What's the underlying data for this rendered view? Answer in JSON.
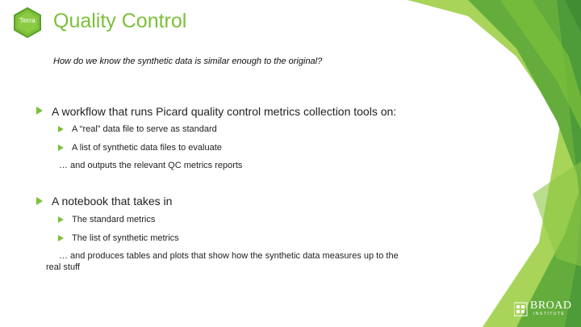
{
  "slide": {
    "title": "Quality Control",
    "subtitle": "How do we know the synthetic data is similar enough to the original?",
    "logo_text": "Terra",
    "colors": {
      "accent_green": "#7cc03a",
      "dark_green": "#4e9b3a",
      "mid_green": "#64ad3c",
      "light_green": "#a8d45a"
    },
    "bullets": [
      {
        "text": "A workflow that runs Picard quality control metrics collection tools on:",
        "sub": [
          "A “real” data file to serve as standard",
          "A list of synthetic data files to evaluate"
        ],
        "continuation": [
          "… and outputs the relevant QC metrics reports"
        ]
      },
      {
        "text": "A notebook that takes in",
        "sub": [
          "The standard metrics",
          "The list of synthetic metrics"
        ],
        "continuation": [
          "… and produces tables and plots that show how the synthetic data measures up to the",
          "real stuff"
        ]
      }
    ],
    "broad_logo": {
      "main": "BROAD",
      "sub": "INSTITUTE"
    }
  }
}
